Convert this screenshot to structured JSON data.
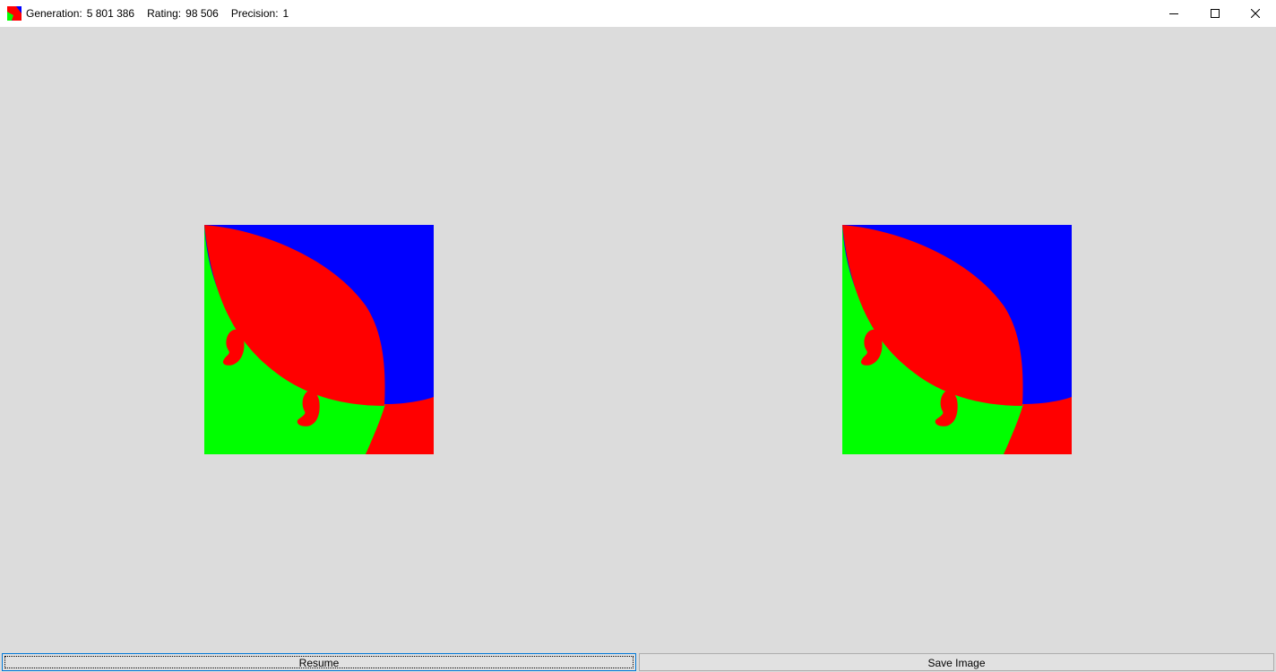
{
  "window": {
    "generation_label": "Generation:",
    "generation_value": "5 801 386",
    "rating_label": "Rating:",
    "rating_value": "98 506",
    "precision_label": "Precision:",
    "precision_value": "1",
    "icons": {
      "app": "app-icon",
      "minimize": "minimize-icon",
      "maximize": "maximize-icon",
      "close": "close-icon"
    }
  },
  "images": {
    "colors": {
      "blue": "#0000ff",
      "red": "#ff0000",
      "green": "#00ff00"
    }
  },
  "buttons": {
    "resume_label": "Resume",
    "save_label": "Save Image"
  }
}
